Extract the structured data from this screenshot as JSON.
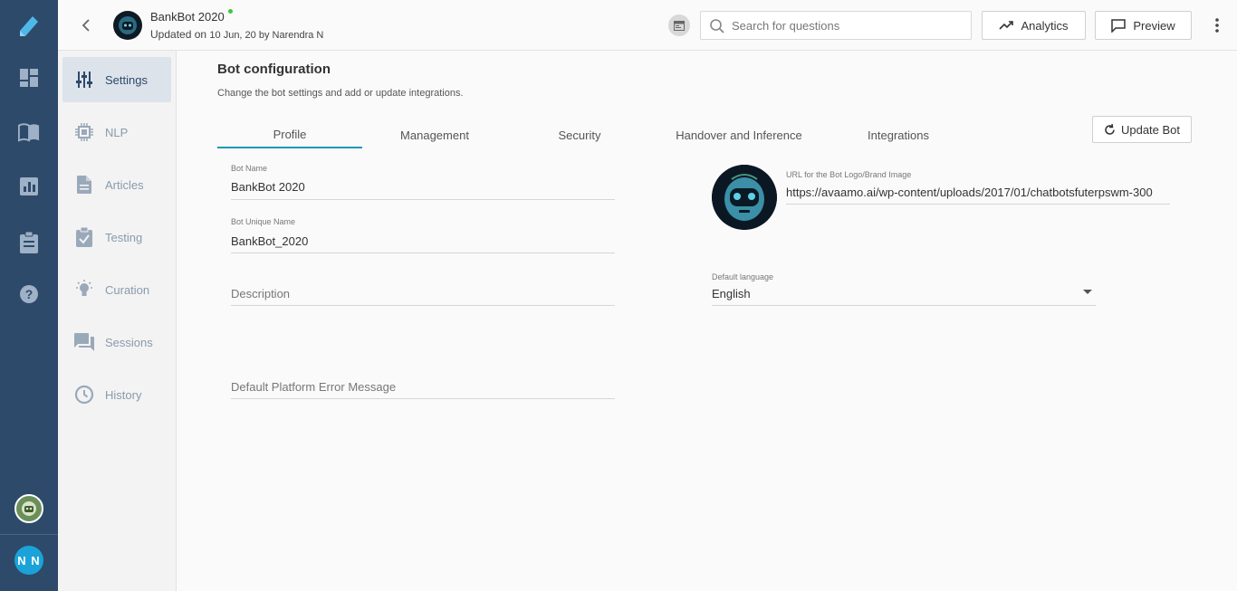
{
  "colors": {
    "rail_bg": "#2d4a6b",
    "accent": "#2196b8",
    "online": "#3ec83e",
    "user_avatar": "#1ba3d9"
  },
  "rail": {
    "icons": [
      "avaamo-logo-icon",
      "dashboard-icon",
      "book-icon",
      "bar-chart-icon",
      "clipboard-icon",
      "help-icon"
    ],
    "user_initials": "N N"
  },
  "header": {
    "bot_name": "BankBot 2020",
    "updated_prefix": "Updated on",
    "updated_rest": "10 Jun, 20 by Narendra N",
    "search_placeholder": "Search for questions",
    "analytics_label": "Analytics",
    "preview_label": "Preview"
  },
  "subnav": {
    "items": [
      {
        "label": "Settings",
        "icon": "sliders-icon",
        "active": true
      },
      {
        "label": "NLP",
        "icon": "chip-icon",
        "active": false
      },
      {
        "label": "Articles",
        "icon": "document-icon",
        "active": false
      },
      {
        "label": "Testing",
        "icon": "clipboard-check-icon",
        "active": false
      },
      {
        "label": "Curation",
        "icon": "lightbulb-icon",
        "active": false
      },
      {
        "label": "Sessions",
        "icon": "chat-icon",
        "active": false
      },
      {
        "label": "History",
        "icon": "history-icon",
        "active": false
      }
    ]
  },
  "main": {
    "title": "Bot configuration",
    "subtitle": "Change the bot settings and add or update integrations.",
    "update_label": "Update Bot",
    "tabs": [
      {
        "label": "Profile",
        "active": true
      },
      {
        "label": "Management",
        "active": false
      },
      {
        "label": "Security",
        "active": false
      },
      {
        "label": "Handover and Inference",
        "active": false
      },
      {
        "label": "Integrations",
        "active": false
      }
    ],
    "form": {
      "bot_name_label": "Bot Name",
      "bot_name_value": "BankBot 2020",
      "unique_name_label": "Bot Unique Name",
      "unique_name_value": "BankBot_2020",
      "description_placeholder": "Description",
      "error_msg_placeholder": "Default Platform Error Message",
      "logo_url_label": "URL for the Bot Logo/Brand Image",
      "logo_url_value": "https://avaamo.ai/wp-content/uploads/2017/01/chatbotsfuterpswm-300",
      "language_label": "Default language",
      "language_value": "English"
    }
  }
}
